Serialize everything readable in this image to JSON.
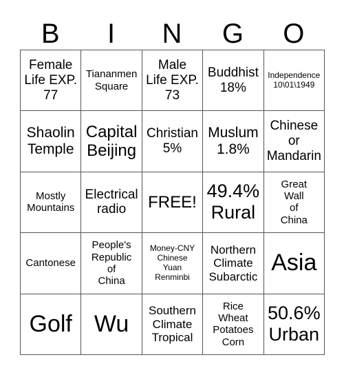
{
  "header": {
    "letters": [
      "B",
      "I",
      "N",
      "G",
      "O"
    ]
  },
  "cells": [
    {
      "text": "Female\nLife EXP.\n77",
      "size": "s-mdl"
    },
    {
      "text": "Tiananmen\nSquare",
      "size": "s-sm"
    },
    {
      "text": "Male\nLife EXP.\n73",
      "size": "s-mdl"
    },
    {
      "text": "Buddhist\n18%",
      "size": "s-mdl"
    },
    {
      "text": "Independence\n10\\01\\1949",
      "size": "s-xs"
    },
    {
      "text": "Shaolin\nTemple",
      "size": "s-lg"
    },
    {
      "text": "Capital\nBeijing",
      "size": "s-xl"
    },
    {
      "text": "Christian\n5%",
      "size": "s-mdl"
    },
    {
      "text": "Muslum\n1.8%",
      "size": "s-lg"
    },
    {
      "text": "Chinese\nor\nMandarin",
      "size": "s-mdl"
    },
    {
      "text": "Mostly\nMountains",
      "size": "s-sm"
    },
    {
      "text": "Electrical\nradio",
      "size": "s-mdl"
    },
    {
      "text": "FREE!",
      "size": "s-xl"
    },
    {
      "text": "49.4%\nRural",
      "size": "s-xxl"
    },
    {
      "text": "Great\nWall\nof\nChina",
      "size": "s-sm"
    },
    {
      "text": "Cantonese",
      "size": "s-sm"
    },
    {
      "text": "People's\nRepublic\nof\nChina",
      "size": "s-sm"
    },
    {
      "text": "Money-CNY\nChinese\nYuan\nRenminbi",
      "size": "s-xs"
    },
    {
      "text": "Northern\nClimate\nSubarctic",
      "size": "s-md"
    },
    {
      "text": "Asia",
      "size": "s-huge"
    },
    {
      "text": "Golf",
      "size": "s-huge"
    },
    {
      "text": "Wu",
      "size": "s-huge"
    },
    {
      "text": "Southern\nClimate\nTropical",
      "size": "s-md"
    },
    {
      "text": "Rice\nWheat\nPotatoes\nCorn",
      "size": "s-sm"
    },
    {
      "text": "50.6%\nUrban",
      "size": "s-xxl"
    }
  ]
}
